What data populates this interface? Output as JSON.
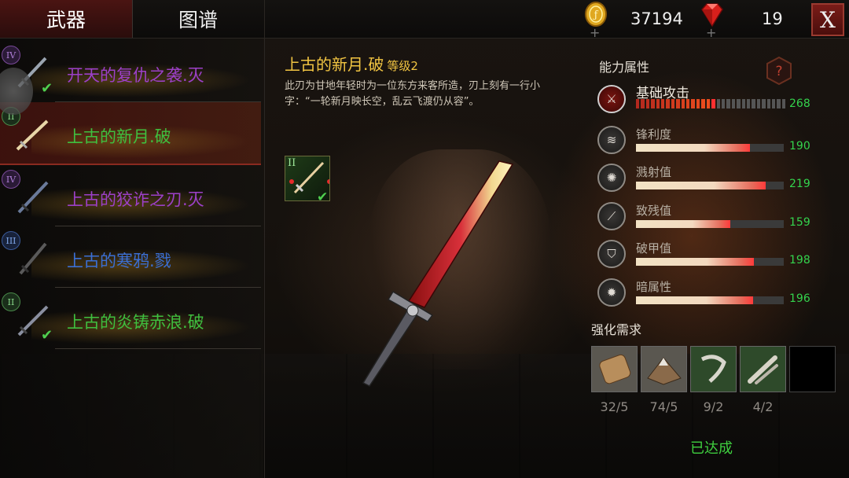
{
  "tabs": [
    {
      "label": "武器",
      "active": true
    },
    {
      "label": "图谱",
      "active": false
    }
  ],
  "currency": {
    "gold_icon": "gold-coin-icon",
    "gold_value": "37194",
    "gem_icon": "ruby-gem-icon",
    "gem_value": "19",
    "plus_symbol": "+"
  },
  "close_label": "X",
  "weapons": [
    {
      "rank": "IV",
      "name": "开天的复仇之袭.灭",
      "color": "#9c40c8",
      "owned": true,
      "selected": false
    },
    {
      "rank": "II",
      "name": "上古的新月.破",
      "color": "#3fbf3f",
      "owned": false,
      "selected": true
    },
    {
      "rank": "IV",
      "name": "上古的狡诈之刃.灭",
      "color": "#9c40c8",
      "owned": false,
      "selected": false
    },
    {
      "rank": "III",
      "name": "上古的寒鸦.戮",
      "color": "#3b6fd4",
      "owned": false,
      "selected": false
    },
    {
      "rank": "II",
      "name": "上古的炎铸赤浪.破",
      "color": "#3fbf3f",
      "owned": true,
      "selected": false
    }
  ],
  "detail": {
    "name": "上古的新月.破",
    "level": "等级2",
    "description": "此刃为甘地年轻时为一位东方来客所造，刃上刻有一行小字：“一轮新月映长空，乱云飞渡仍从容”。",
    "slot_rank": "II"
  },
  "stats_title": "能力属性",
  "help_label": "?",
  "base_stat": {
    "name": "基础攻击",
    "value": "268",
    "segments_total": 30,
    "segments_filled": 16,
    "icon": "sword-emblem-icon"
  },
  "stats": [
    {
      "name": "锋利度",
      "value": "190",
      "fill": 0.77,
      "icon": "sharpness-icon"
    },
    {
      "name": "溅射值",
      "value": "219",
      "fill": 0.88,
      "icon": "splash-icon"
    },
    {
      "name": "致残值",
      "value": "159",
      "fill": 0.64,
      "icon": "cripple-icon"
    },
    {
      "name": "破甲值",
      "value": "198",
      "fill": 0.8,
      "icon": "armor-break-icon"
    },
    {
      "name": "暗属性",
      "value": "196",
      "fill": 0.79,
      "icon": "dark-element-icon"
    }
  ],
  "requirements_title": "强化需求",
  "requirements": [
    {
      "item": "wood-log-icon",
      "count": "32/5",
      "bg": "#5a5750"
    },
    {
      "item": "ore-pile-icon",
      "count": "74/5",
      "bg": "#5a5750"
    },
    {
      "item": "claw-icon",
      "count": "9/2",
      "bg": "#2e4a2a"
    },
    {
      "item": "bone-icon",
      "count": "4/2",
      "bg": "#2e4a2a"
    },
    {
      "item": "empty-slot",
      "count": "",
      "bg": "#000000"
    }
  ],
  "completed_label": "已达成"
}
